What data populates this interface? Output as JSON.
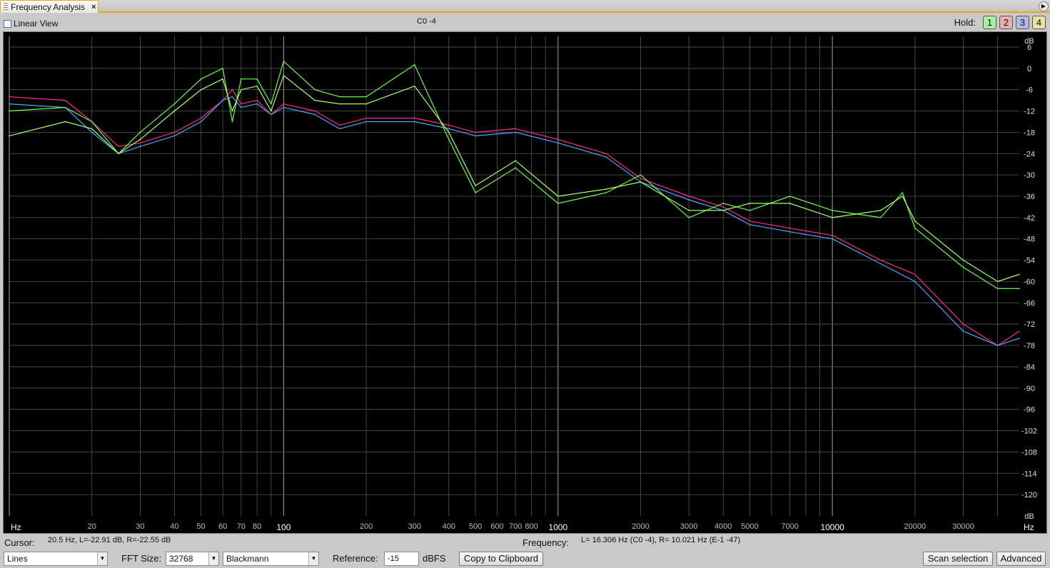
{
  "tab": {
    "title": "Frequency Analysis",
    "close": "×"
  },
  "top": {
    "linear_view": "Linear View",
    "note": "C0 -4",
    "hold_label": "Hold:",
    "hold_buttons": [
      {
        "label": "1",
        "color": "#a8f0a0"
      },
      {
        "label": "2",
        "color": "#e8b0b0"
      },
      {
        "label": "3",
        "color": "#b8b8e8"
      },
      {
        "label": "4",
        "color": "#e8e4a8"
      }
    ]
  },
  "chart_data": {
    "type": "line",
    "x_scale": "log",
    "xlim": [
      10,
      48000
    ],
    "ylim": [
      -126,
      9
    ],
    "y_axis_unit": "dB",
    "x_axis_unit": "Hz",
    "grid": true,
    "background": "#000000",
    "y_ticks": [
      6,
      0,
      -6,
      -12,
      -18,
      -24,
      -30,
      -36,
      -42,
      -48,
      -54,
      -60,
      -66,
      -72,
      -78,
      -84,
      -90,
      -96,
      -102,
      -108,
      -114,
      -120
    ],
    "x_ticks_small": [
      20,
      30,
      40,
      50,
      60,
      70,
      80,
      200,
      300,
      400,
      500,
      600,
      700,
      800,
      2000,
      3000,
      4000,
      5000,
      7000,
      20000,
      30000
    ],
    "x_ticks_bold": [
      100,
      1000,
      10000
    ],
    "series": [
      {
        "color": "#ff2a8a",
        "x": [
          10,
          16,
          20,
          25,
          30,
          40,
          50,
          60,
          65,
          70,
          80,
          90,
          100,
          130,
          160,
          200,
          300,
          400,
          500,
          700,
          1000,
          1500,
          2000,
          3000,
          4000,
          5000,
          7000,
          10000,
          15000,
          20000,
          30000,
          40000,
          48000
        ],
        "y": [
          -8,
          -9,
          -15,
          -22,
          -21,
          -18,
          -14,
          -9,
          -6,
          -10,
          -9,
          -13,
          -10,
          -12,
          -16,
          -14,
          -14,
          -16,
          -18,
          -17,
          -20,
          -24,
          -31,
          -36,
          -39,
          -43,
          -45,
          -47,
          -54,
          -58,
          -72,
          -78,
          -74
        ]
      },
      {
        "color": "#4aa8ff",
        "x": [
          10,
          16,
          20,
          25,
          30,
          40,
          50,
          60,
          65,
          70,
          80,
          90,
          100,
          130,
          160,
          200,
          300,
          400,
          500,
          700,
          1000,
          1500,
          2000,
          3000,
          4000,
          5000,
          7000,
          10000,
          15000,
          20000,
          30000,
          40000,
          48000
        ],
        "y": [
          -10,
          -11,
          -18,
          -24,
          -22,
          -19,
          -15,
          -9,
          -8,
          -11,
          -10,
          -13,
          -11,
          -13,
          -17,
          -15,
          -15,
          -17,
          -19,
          -18,
          -21,
          -25,
          -32,
          -37,
          -40,
          -44,
          -46,
          -48,
          -55,
          -60,
          -74,
          -78,
          -76
        ]
      },
      {
        "color": "#66ff44",
        "x": [
          10,
          16,
          20,
          25,
          30,
          40,
          50,
          60,
          65,
          70,
          80,
          90,
          100,
          130,
          160,
          200,
          300,
          400,
          500,
          700,
          1000,
          1500,
          2000,
          3000,
          4000,
          5000,
          7000,
          10000,
          15000,
          18000,
          20000,
          30000,
          40000,
          48000
        ],
        "y": [
          -12,
          -11,
          -15,
          -24,
          -18,
          -10,
          -3,
          0,
          -15,
          -3,
          -3,
          -10,
          2,
          -6,
          -8,
          -8,
          1,
          -20,
          -35,
          -28,
          -38,
          -35,
          -30,
          -42,
          -38,
          -40,
          -36,
          -40,
          -42,
          -35,
          -45,
          -56,
          -62,
          -62
        ]
      },
      {
        "color": "#a8ff66",
        "x": [
          10,
          16,
          20,
          25,
          30,
          40,
          50,
          60,
          65,
          70,
          80,
          90,
          100,
          130,
          160,
          200,
          300,
          400,
          500,
          700,
          1000,
          1500,
          2000,
          3000,
          4000,
          5000,
          7000,
          10000,
          15000,
          18000,
          20000,
          30000,
          40000,
          48000
        ],
        "y": [
          -19,
          -15,
          -17,
          -24,
          -20,
          -12,
          -6,
          -3,
          -12,
          -6,
          -5,
          -12,
          -2,
          -9,
          -10,
          -10,
          -5,
          -18,
          -33,
          -26,
          -36,
          -34,
          -32,
          -40,
          -40,
          -38,
          -38,
          -42,
          -40,
          -36,
          -43,
          -54,
          -60,
          -58
        ]
      }
    ]
  },
  "bottom": {
    "cursor_label": "Cursor:",
    "cursor_value": "20.5 Hz, L=-22.91 dB, R=-22.55 dB",
    "frequency_label": "Frequency:",
    "frequency_value": "L= 16.306 Hz (C0 -4), R= 10.021 Hz (E-1 -47)",
    "mode": "Lines",
    "fft_label": "FFT Size:",
    "fft_size": "32768",
    "window": "Blackmann",
    "reference_label": "Reference:",
    "reference_value": "-15",
    "reference_unit": "dBFS",
    "copy_button": "Copy to Clipboard",
    "scan_button": "Scan selection",
    "advanced_button": "Advanced"
  }
}
